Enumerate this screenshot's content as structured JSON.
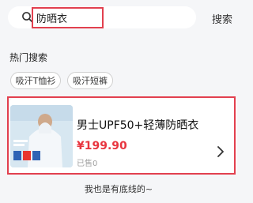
{
  "search": {
    "value": "防晒衣",
    "button_label": "搜索"
  },
  "hot_search": {
    "title": "热门搜索",
    "tags": [
      "吸汗T恤衫",
      "吸汗短裤"
    ]
  },
  "product": {
    "title": "男士UPF50+轻薄防晒衣",
    "price": "¥199.90",
    "sold": "已售0"
  },
  "footer": {
    "end_text": "我也是有底线的~"
  },
  "colors": {
    "highlight": "#e2404f",
    "price": "#e8353f"
  },
  "icons": {
    "search": "search-icon",
    "chevron": "chevron-right-icon"
  }
}
